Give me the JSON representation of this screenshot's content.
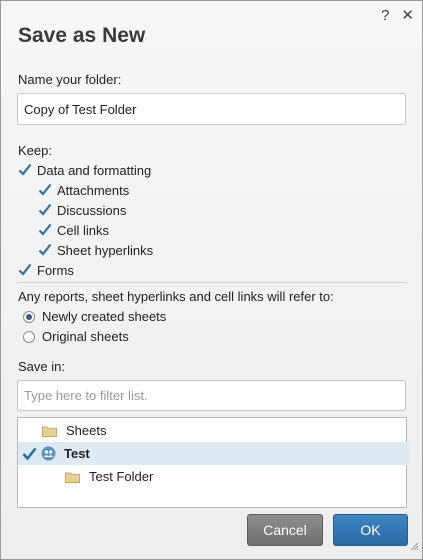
{
  "dialog": {
    "title": "Save as New",
    "help_label": "?",
    "close_label": "✕"
  },
  "name_section": {
    "label": "Name your folder:",
    "value": "Copy of Test Folder"
  },
  "keep_section": {
    "label": "Keep:",
    "options": [
      {
        "label": "Data and formatting",
        "checked": true
      },
      {
        "label": "Attachments",
        "checked": true
      },
      {
        "label": "Discussions",
        "checked": true
      },
      {
        "label": "Cell links",
        "checked": true
      },
      {
        "label": "Sheet hyperlinks",
        "checked": true
      },
      {
        "label": "Forms",
        "checked": true
      }
    ]
  },
  "links_section": {
    "label": "Any reports, sheet hyperlinks and cell links will refer to:",
    "options": [
      {
        "label": "Newly created sheets",
        "selected": true
      },
      {
        "label": "Original sheets",
        "selected": false
      }
    ]
  },
  "save_in": {
    "label": "Save in:",
    "filter_placeholder": "Type here to filter list.",
    "items": [
      {
        "label": "Sheets",
        "icon": "folder-icon",
        "selected": false
      },
      {
        "label": "Test",
        "icon": "workspace-icon",
        "selected": true
      },
      {
        "label": "Test Folder",
        "icon": "folder-icon",
        "selected": false
      }
    ]
  },
  "buttons": {
    "cancel": "Cancel",
    "ok": "OK"
  },
  "colors": {
    "accent": "#2a6aa6",
    "check": "#2f6fa7",
    "selection": "#dde9f3"
  }
}
